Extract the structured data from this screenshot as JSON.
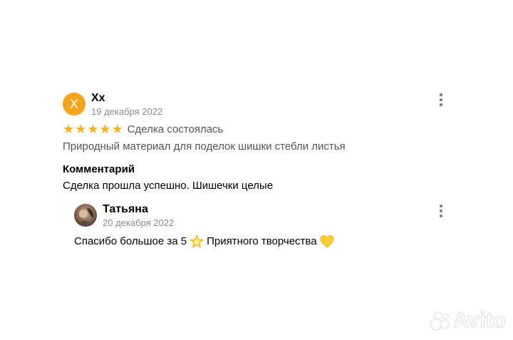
{
  "review": {
    "avatar_letter": "X",
    "avatar_color": "#f5a31a",
    "author": "Хх",
    "date": "19 декабря 2022",
    "rating": 5,
    "rating_max": 5,
    "stars": [
      "★",
      "★",
      "★",
      "★",
      "★"
    ],
    "deal_status": "Сделка состоялась",
    "item_title": "Природный материал для поделок шишки стебли листья",
    "comment_heading": "Комментарий",
    "comment_text": "Сделка прошла успешно. Шишечки целые",
    "menu_icon": "more-vertical-icon"
  },
  "reply": {
    "author": "Татьяна",
    "date": "20 декабря 2022",
    "text_before_emoji": "Спасибо большое за 5",
    "text_after_emoji": "Приятного творчества",
    "emoji_1": "glowing-star-emoji",
    "emoji_2": "yellow-heart-emoji",
    "menu_icon": "more-vertical-icon"
  },
  "watermark": {
    "text": "Avito"
  },
  "colors": {
    "star": "#ffb021",
    "muted_text": "#8a8a8a"
  }
}
